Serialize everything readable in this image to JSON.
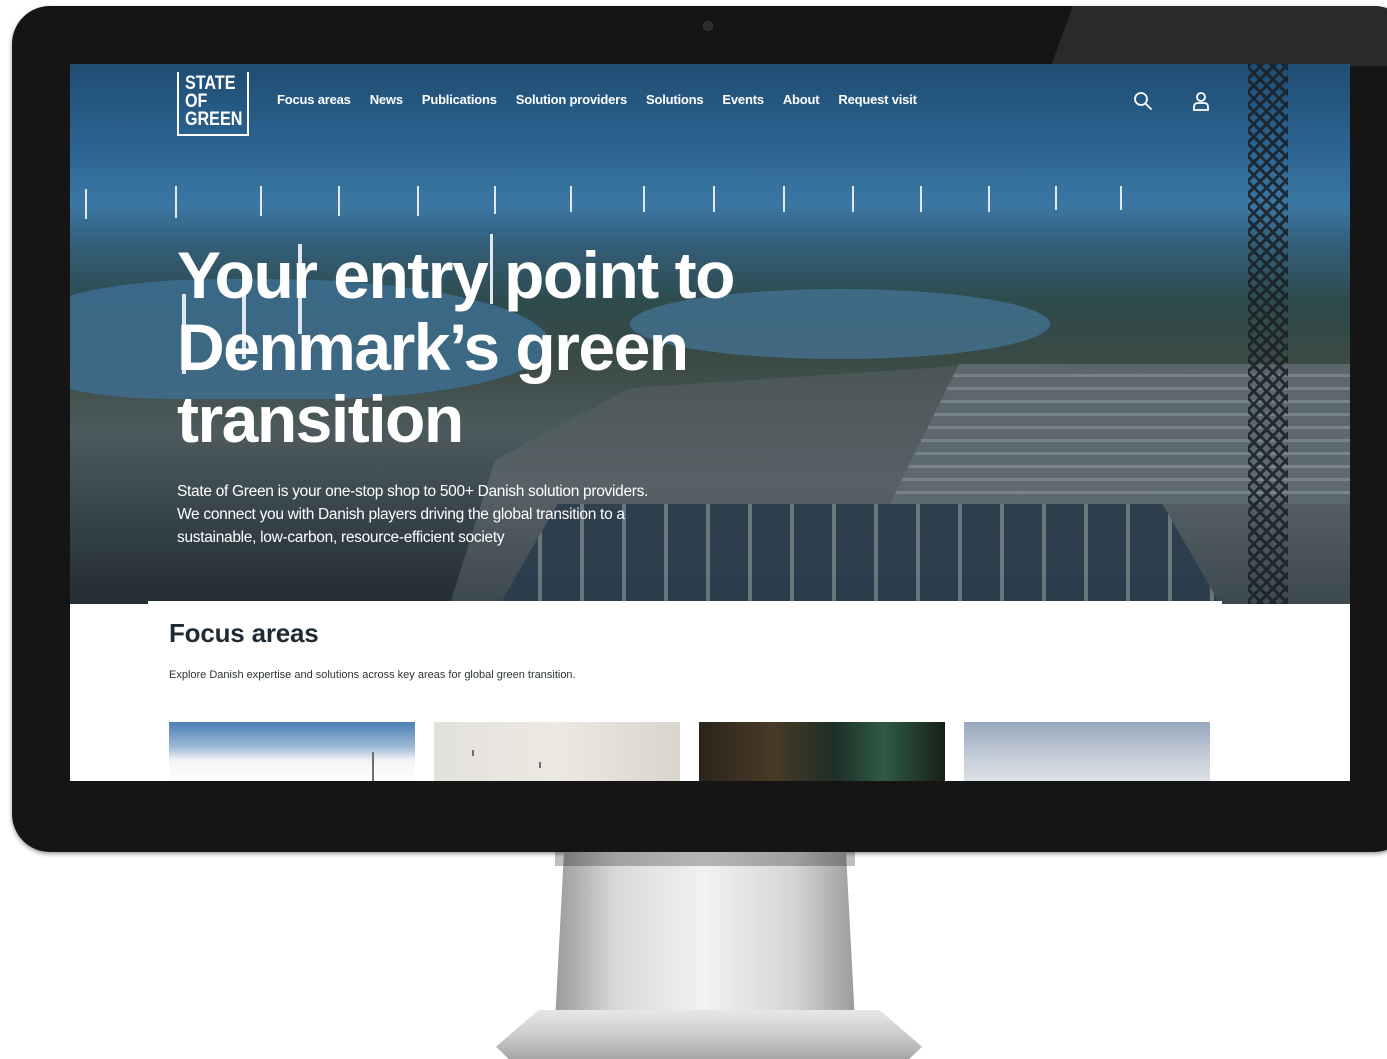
{
  "site": {
    "logo_lines": [
      "STATE",
      "OF",
      "GREEN"
    ]
  },
  "nav": {
    "items": [
      {
        "label": "Focus areas"
      },
      {
        "label": "News"
      },
      {
        "label": "Publications"
      },
      {
        "label": "Solution providers"
      },
      {
        "label": "Solutions"
      },
      {
        "label": "Events"
      },
      {
        "label": "About"
      },
      {
        "label": "Request visit"
      }
    ],
    "icons": [
      "search-icon",
      "user-icon"
    ]
  },
  "hero": {
    "title": "Your entry point to Denmark’s green transition",
    "description": "State of Green is your one-stop shop to 500+ Danish solution providers. We connect you with Danish players driving the global transition to a sustainable, low-carbon, resource-efficient society"
  },
  "focus_areas": {
    "title": "Focus areas",
    "subtitle": "Explore Danish expertise and solutions across key areas for global green transition."
  },
  "colors": {
    "bezel": "#151515",
    "heading": "#1f2a33",
    "hero_text": "#ffffff"
  }
}
